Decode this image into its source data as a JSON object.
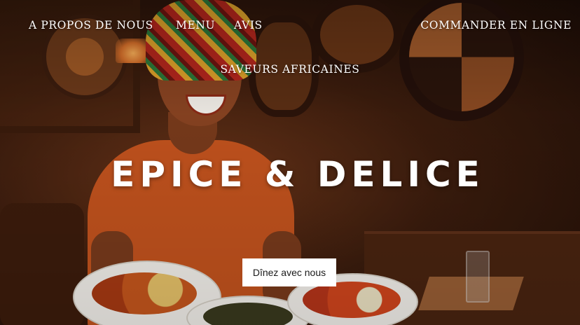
{
  "nav": {
    "about_label": "A PROPOS DE NOUS",
    "menu_label": "MENU",
    "reviews_label": "AVIS",
    "order_label": "COMMANDER EN LIGNE"
  },
  "hero": {
    "tagline": "SAVEURS AFRICAINES",
    "brand_name": "EPICE & DELICE",
    "cta_label": "Dînez avec nous"
  }
}
